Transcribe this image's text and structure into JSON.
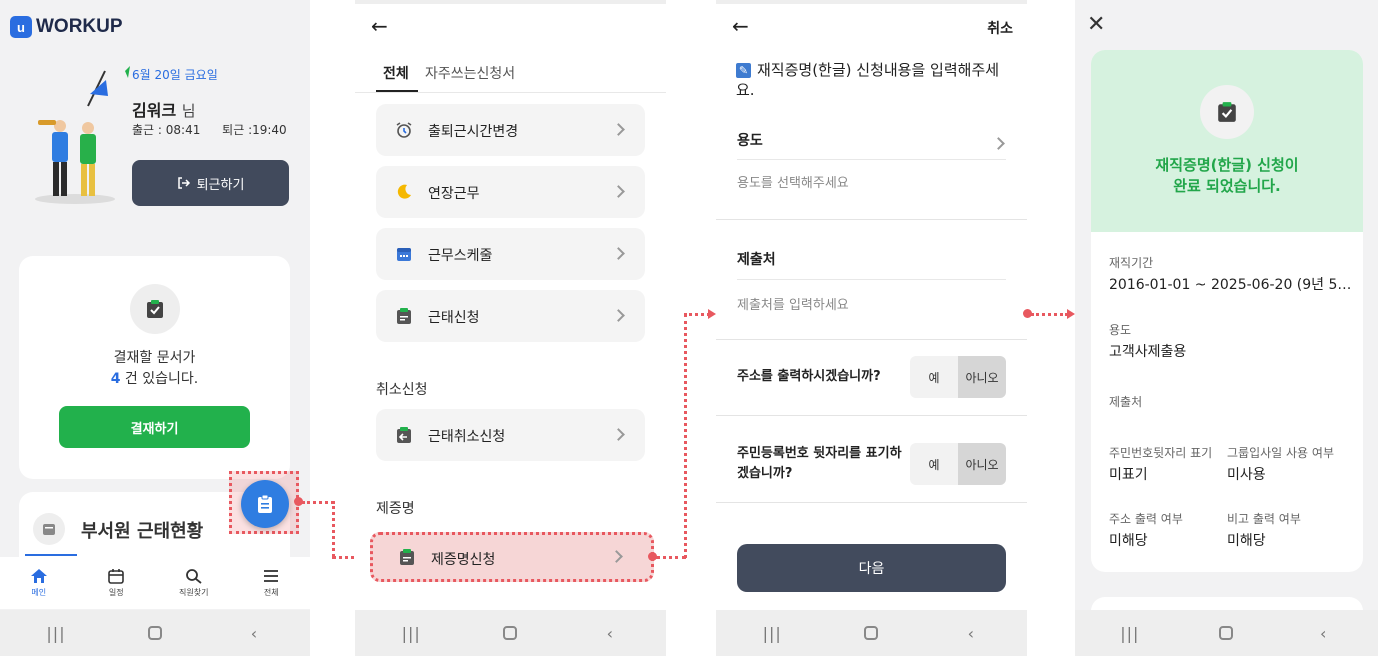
{
  "screen1": {
    "logo_text": "WORKUP",
    "date": "6월 20일 금요일",
    "user_name": "김워크",
    "user_suffix": "님",
    "clock_in": "출근 : 08:41",
    "clock_out": "퇴근 :19:40",
    "leave_button": "퇴근하기",
    "approval_line1": "결재할 문서가",
    "approval_count": "4",
    "approval_line2_suffix": " 건 있습니다.",
    "approve_button": "결재하기",
    "team_status_title": "부서원 근태현황",
    "bottom_tabs": [
      {
        "label": "메인",
        "icon": "home-icon"
      },
      {
        "label": "일정",
        "icon": "calendar-icon"
      },
      {
        "label": "직원찾기",
        "icon": "search-icon"
      },
      {
        "label": "전체",
        "icon": "menu-icon"
      }
    ]
  },
  "screen2": {
    "tabs": [
      "전체",
      "자주쓰는신청서"
    ],
    "items": [
      {
        "label": "출퇴근시간변경",
        "icon": "alarm-clock-icon"
      },
      {
        "label": "연장근무",
        "icon": "moon-icon"
      },
      {
        "label": "근무스케줄",
        "icon": "calendar-icon"
      },
      {
        "label": "근태신청",
        "icon": "clipboard-icon"
      }
    ],
    "cancel_section": "취소신청",
    "cancel_items": [
      {
        "label": "근태취소신청",
        "icon": "clipboard-return-icon"
      }
    ],
    "cert_section": "제증명",
    "cert_items": [
      {
        "label": "제증명신청",
        "icon": "clipboard-icon"
      }
    ]
  },
  "screen3": {
    "cancel": "취소",
    "heading": "재직증명(한글) 신청내용을 입력해주세요.",
    "purpose_label": "용도",
    "purpose_placeholder": "용도를 선택해주세요",
    "submit_label": "제출처",
    "submit_placeholder": "제출처를 입력하세요",
    "q_address": "주소를 출력하시겠습니까?",
    "q_ssn": "주민등록번호 뒷자리를 표기하겠습니까?",
    "yes": "예",
    "no": "아니오",
    "next_button": "다음"
  },
  "screen4": {
    "title_line1": "재직증명(한글) 신청이",
    "title_line2": "완료 되었습니다.",
    "period_label": "재직기간",
    "period_value": "2016-01-01 ~ 2025-06-20 (9년 5…",
    "purpose_label": "용도",
    "purpose_value": "고객사제출용",
    "submit_label": "제출처",
    "ssn_label": "주민번호뒷자리 표기",
    "ssn_value": "미표기",
    "group_label": "그룹입사일 사용 여부",
    "group_value": "미사용",
    "address_label": "주소 출력 여부",
    "address_value": "미해당",
    "note_label": "비고 출력 여부",
    "note_value": "미해당"
  },
  "colors": {
    "primary_blue": "#2a6de0",
    "green": "#22b14c",
    "dark_button": "#424b5d",
    "highlight_red": "#e8585f",
    "success_bg": "#d6f2df"
  }
}
